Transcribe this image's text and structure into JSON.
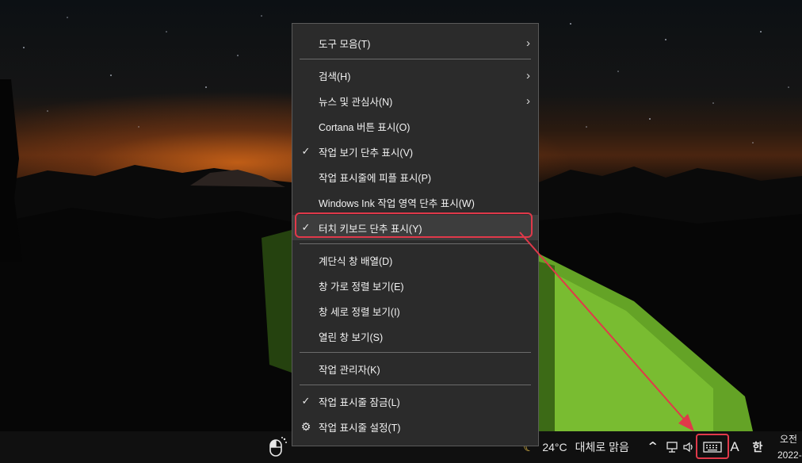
{
  "menu": {
    "groups": [
      [
        {
          "label": "도구 모음(T)",
          "submenu": true,
          "checked": false,
          "gear": false
        }
      ],
      [
        {
          "label": "검색(H)",
          "submenu": true,
          "checked": false,
          "gear": false
        },
        {
          "label": "뉴스 및 관심사(N)",
          "submenu": true,
          "checked": false,
          "gear": false
        },
        {
          "label": "Cortana 버튼 표시(O)",
          "submenu": false,
          "checked": false,
          "gear": false
        },
        {
          "label": "작업 보기 단추 표시(V)",
          "submenu": false,
          "checked": true,
          "gear": false
        },
        {
          "label": "작업 표시줄에 피플 표시(P)",
          "submenu": false,
          "checked": false,
          "gear": false
        },
        {
          "label": "Windows Ink 작업 영역 단추 표시(W)",
          "submenu": false,
          "checked": false,
          "gear": false
        },
        {
          "label": "터치 키보드 단추 표시(Y)",
          "submenu": false,
          "checked": true,
          "gear": false,
          "highlighted": true
        }
      ],
      [
        {
          "label": "계단식 창 배열(D)",
          "submenu": false,
          "checked": false,
          "gear": false
        },
        {
          "label": "창 가로 정렬 보기(E)",
          "submenu": false,
          "checked": false,
          "gear": false
        },
        {
          "label": "창 세로 정렬 보기(I)",
          "submenu": false,
          "checked": false,
          "gear": false
        },
        {
          "label": "열린 창 보기(S)",
          "submenu": false,
          "checked": false,
          "gear": false
        }
      ],
      [
        {
          "label": "작업 관리자(K)",
          "submenu": false,
          "checked": false,
          "gear": false
        }
      ],
      [
        {
          "label": "작업 표시줄 잠금(L)",
          "submenu": false,
          "checked": true,
          "gear": false
        },
        {
          "label": "작업 표시줄 설정(T)",
          "submenu": false,
          "checked": false,
          "gear": true
        }
      ]
    ]
  },
  "taskbar": {
    "weather_temp": "24°C",
    "weather_text": "대체로 맑음",
    "ime_mode": "A",
    "ime_lang": "한",
    "clock_period": "오전",
    "clock_date": "2022-"
  },
  "icons": {
    "check": "✓",
    "submenu_arrow": "›",
    "gear": "⚙",
    "chevron_up": "^"
  },
  "colors": {
    "annotation": "#e0394a",
    "menu_bg": "#2b2b2b",
    "taskbar_bg": "#101010"
  }
}
